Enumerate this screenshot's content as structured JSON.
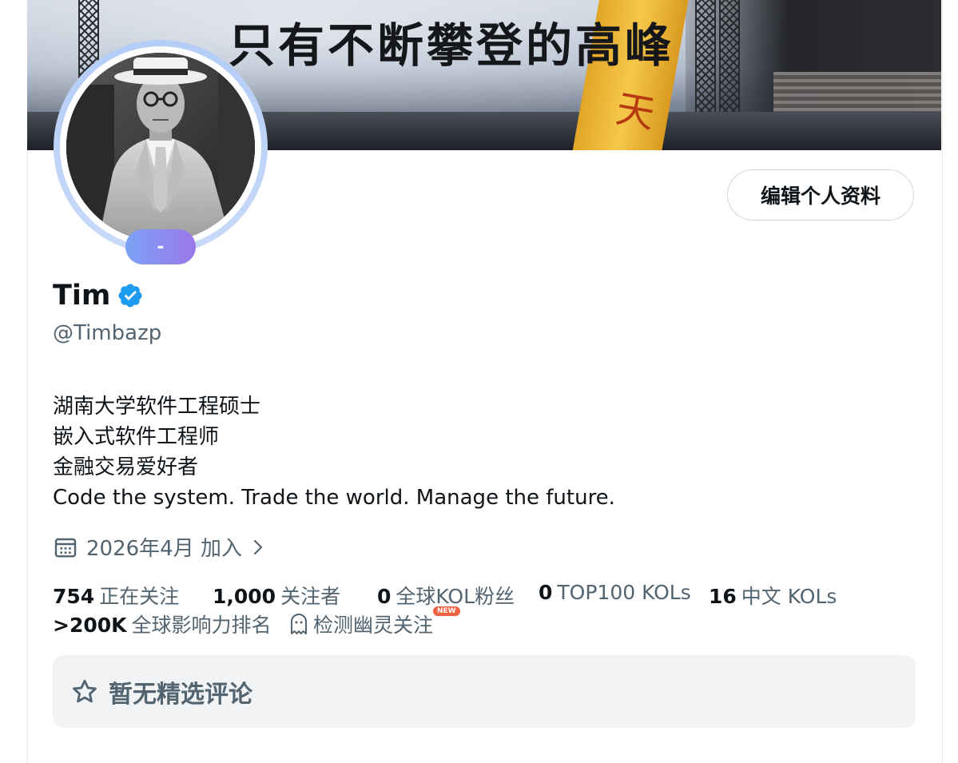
{
  "banner": {
    "slogan": "只有不断攀登的高峰",
    "sign_text": "天"
  },
  "avatar": {
    "badge_text": "-"
  },
  "profile": {
    "edit_button_label": "编辑个人资料",
    "display_name": "Tim",
    "handle": "@Timbazp",
    "bio_lines": [
      "湖南大学软件工程硕士",
      "嵌入式软件工程师",
      "金融交易爱好者",
      "Code the system. Trade the world. Manage the future."
    ],
    "joined": "2026年4月 加入"
  },
  "stats": {
    "following": {
      "value": "754",
      "label": "正在关注"
    },
    "followers": {
      "value": "1,000",
      "label": "关注者"
    },
    "kol_fans": {
      "value": "0",
      "label": "全球KOL粉丝"
    },
    "top100": {
      "value": "0",
      "label": "TOP100 KOLs"
    },
    "chinese_kols": {
      "value": "16",
      "label": "中文 KOLs"
    },
    "influence_rank": {
      "value": ">200K",
      "label": "全球影响力排名"
    },
    "ghost_check": {
      "label": "检测幽灵关注",
      "badge": "NEW"
    }
  },
  "featured": {
    "empty_text": "暂无精选评论"
  },
  "colors": {
    "verified_blue": "#1d9bf0",
    "secondary_text": "#536471",
    "primary_text": "#0f1419",
    "new_badge": "#f0623f"
  },
  "icons": [
    "verified-icon",
    "calendar-icon",
    "chevron-right-icon",
    "ghost-icon",
    "star-icon"
  ]
}
